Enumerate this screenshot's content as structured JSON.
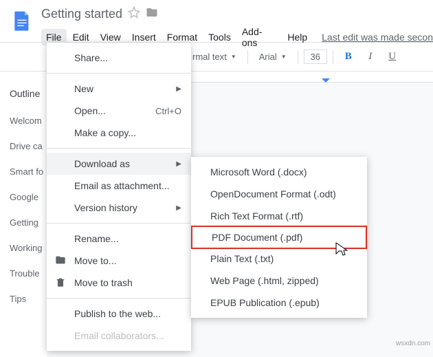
{
  "doc": {
    "title": "Getting started",
    "last_edit": "Last edit was made secon"
  },
  "menu": {
    "file": "File",
    "edit": "Edit",
    "view": "View",
    "insert": "Insert",
    "format": "Format",
    "tools": "Tools",
    "addons": "Add-ons",
    "help": "Help"
  },
  "toolbar": {
    "style": "rmal text",
    "font": "Arial",
    "size": "36"
  },
  "outline": {
    "title": "Outline",
    "items": [
      "Welcom",
      "Drive ca",
      "Smart fo",
      "Google",
      "Getting",
      "Working",
      "Trouble",
      "Tips"
    ]
  },
  "fileMenu": {
    "share": "Share...",
    "new": "New",
    "open": "Open...",
    "open_shortcut": "Ctrl+O",
    "copy": "Make a copy...",
    "download": "Download as",
    "email_attach": "Email as attachment...",
    "version": "Version history",
    "rename": "Rename...",
    "move": "Move to...",
    "trash": "Move to trash",
    "publish": "Publish to the web...",
    "email_collab": "Email collaborators..."
  },
  "downloadMenu": {
    "docx": "Microsoft Word (.docx)",
    "odt": "OpenDocument Format (.odt)",
    "rtf": "Rich Text Format (.rtf)",
    "pdf": "PDF Document (.pdf)",
    "txt": "Plain Text (.txt)",
    "html": "Web Page (.html, zipped)",
    "epub": "EPUB Publication (.epub)"
  },
  "watermark": "wsxdn.com"
}
